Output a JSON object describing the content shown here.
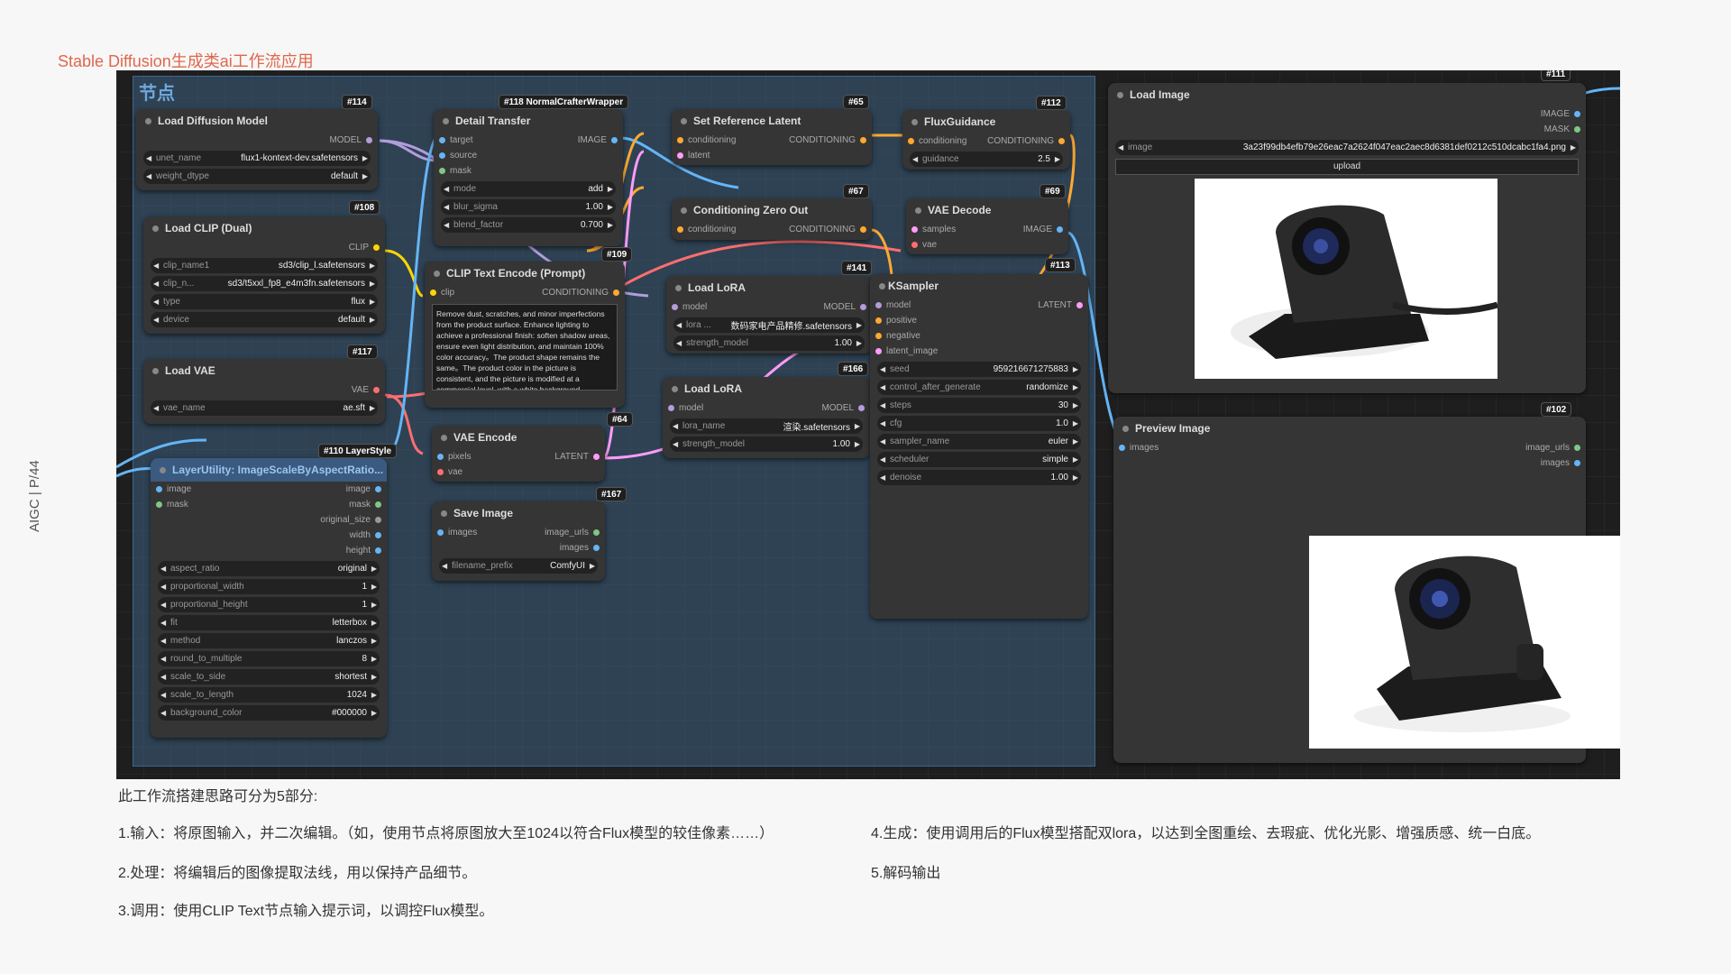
{
  "page_title": "Stable Diffusion生成类ai工作流应用",
  "side_label": "AIGC  |   P/44",
  "group_title": "节点",
  "nodes": {
    "load_diffusion": {
      "badge": "#114",
      "title": "Load Diffusion Model",
      "out": "MODEL",
      "w": [
        [
          "unet_name",
          "flux1-kontext-dev.safetensors"
        ],
        [
          "weight_dtype",
          "default"
        ]
      ]
    },
    "load_clip": {
      "badge": "#108",
      "title": "Load CLIP (Dual)",
      "out": "CLIP",
      "w": [
        [
          "clip_name1",
          "sd3/clip_l.safetensors"
        ],
        [
          "clip_n...",
          "sd3/t5xxl_fp8_e4m3fn.safetensors"
        ],
        [
          "type",
          "flux"
        ],
        [
          "device",
          "default"
        ]
      ]
    },
    "load_vae": {
      "badge": "#117",
      "title": "Load VAE",
      "out": "VAE",
      "w": [
        [
          "vae_name",
          "ae.sft"
        ]
      ]
    },
    "layer_utility": {
      "badge": "#110 LayerStyle",
      "title": "LayerUtility: ImageScaleByAspectRatio...",
      "ins": [
        "image",
        "mask"
      ],
      "outs": [
        "image",
        "mask",
        "original_size",
        "width",
        "height"
      ],
      "w": [
        [
          "aspect_ratio",
          "original"
        ],
        [
          "proportional_width",
          "1"
        ],
        [
          "proportional_height",
          "1"
        ],
        [
          "fit",
          "letterbox"
        ],
        [
          "method",
          "lanczos"
        ],
        [
          "round_to_multiple",
          "8"
        ],
        [
          "scale_to_side",
          "shortest"
        ],
        [
          "scale_to_length",
          "1024"
        ],
        [
          "background_color",
          "#000000"
        ]
      ]
    },
    "detail_transfer": {
      "badge": "#118 NormalCrafterWrapper",
      "title": "Detail Transfer",
      "ins": [
        "target",
        "source",
        "mask"
      ],
      "out": "IMAGE",
      "w": [
        [
          "mode",
          "add"
        ],
        [
          "blur_sigma",
          "1.00"
        ],
        [
          "blend_factor",
          "0.700"
        ]
      ]
    },
    "clip_text": {
      "badge": "#109",
      "title": "CLIP Text Encode (Prompt)",
      "in": "clip",
      "out": "CONDITIONING",
      "prompt": "Remove dust, scratches, and minor imperfections from the product surface. Enhance lighting to achieve a professional finish: soften shadow areas, ensure even light distribution, and maintain 100% color accuracy。The product shape remains the same。The product color in the picture is consistent, and the picture is modified at a commercial level, with a white background."
    },
    "vae_encode": {
      "badge": "#64",
      "title": "VAE Encode",
      "ins": [
        "pixels",
        "vae"
      ],
      "out": "LATENT"
    },
    "save_image": {
      "badge": "#167",
      "title": "Save Image",
      "in": "images",
      "outs": [
        "image_urls",
        "images"
      ],
      "w": [
        [
          "filename_prefix",
          "ComfyUI"
        ]
      ]
    },
    "set_ref": {
      "badge": "#65",
      "title": "Set Reference Latent",
      "ins": [
        "conditioning",
        "latent"
      ],
      "out": "CONDITIONING"
    },
    "cond_zero": {
      "badge": "#67",
      "title": "Conditioning Zero Out",
      "in": "conditioning",
      "out": "CONDITIONING"
    },
    "lora1": {
      "badge": "#141",
      "title": "Load LoRA",
      "in": "model",
      "out": "MODEL",
      "w": [
        [
          "lora ...",
          "数码家电产品精修.safetensors"
        ],
        [
          "strength_model",
          "1.00"
        ]
      ]
    },
    "lora2": {
      "badge": "#166",
      "title": "Load LoRA",
      "in": "model",
      "out": "MODEL",
      "w": [
        [
          "lora_name",
          "渲染.safetensors"
        ],
        [
          "strength_model",
          "1.00"
        ]
      ]
    },
    "flux_guidance": {
      "badge": "#112",
      "title": "FluxGuidance",
      "in": "conditioning",
      "out": "CONDITIONING",
      "w": [
        [
          "guidance",
          "2.5"
        ]
      ]
    },
    "vae_decode": {
      "badge": "#69",
      "title": "VAE Decode",
      "ins": [
        "samples",
        "vae"
      ],
      "out": "IMAGE"
    },
    "ksampler": {
      "badge": "#113",
      "title": "KSampler",
      "ins": [
        "model",
        "positive",
        "negative",
        "latent_image"
      ],
      "out": "LATENT",
      "w": [
        [
          "seed",
          "959216671275883"
        ],
        [
          "control_after_generate",
          "randomize"
        ],
        [
          "steps",
          "30"
        ],
        [
          "cfg",
          "1.0"
        ],
        [
          "sampler_name",
          "euler"
        ],
        [
          "scheduler",
          "simple"
        ],
        [
          "denoise",
          "1.00"
        ]
      ]
    },
    "load_image": {
      "badge": "#111",
      "title": "Load Image",
      "outs": [
        "IMAGE",
        "MASK"
      ],
      "w": [
        [
          "image",
          "3a23f99db4efb79e26eac7a2624f047eac2aec8d6381def0212c510dcabc1fa4.png"
        ]
      ],
      "upload": "upload"
    },
    "preview": {
      "badge": "#102",
      "title": "Preview Image",
      "in": "images",
      "outs": [
        "image_urls",
        "images"
      ]
    }
  },
  "footer": {
    "intro": "此工作流搭建思路可分为5部分:",
    "l1": "1.输入：将原图输入，并二次编辑。（如，使用节点将原图放大至1024以符合Flux模型的较佳像素……）",
    "l2": "2.处理：将编辑后的图像提取法线，用以保持产品细节。",
    "l3": "3.调用：使用CLIP Text节点输入提示词，以调控Flux模型。",
    "l4": "4.生成：使用调用后的Flux模型搭配双lora，以达到全图重绘、去瑕疵、优化光影、增强质感、统一白底。",
    "l5": "5.解码输出"
  },
  "colors": {
    "model": "#b39ddb",
    "clip": "#ffd500",
    "vae": "#ff6e6e",
    "image": "#64b5f6",
    "conditioning": "#ffa931",
    "latent": "#ff9cf9",
    "mask": "#81c784"
  }
}
